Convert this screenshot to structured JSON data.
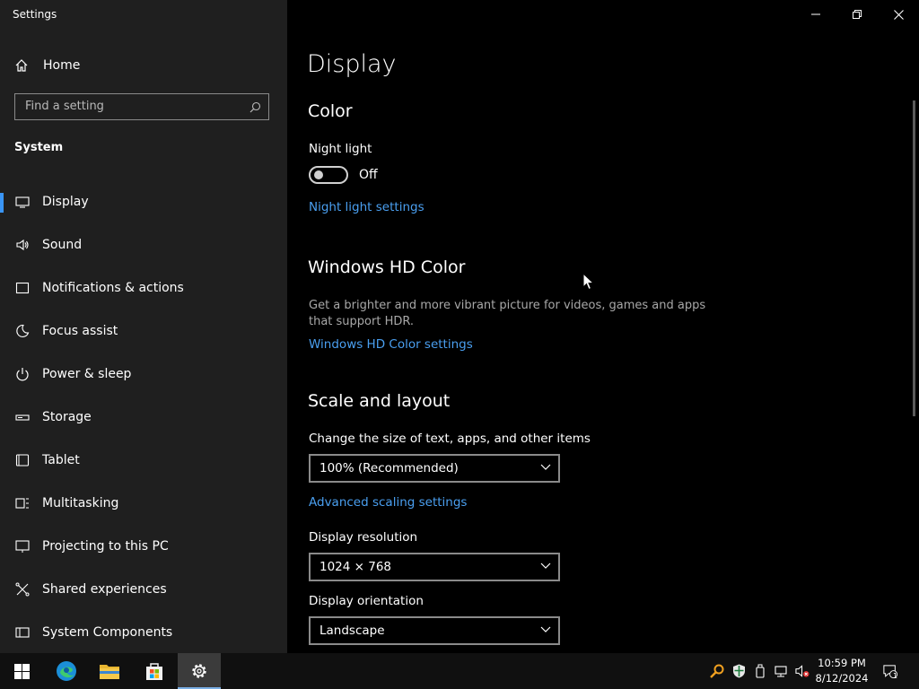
{
  "app": {
    "title": "Settings"
  },
  "sidebar": {
    "home_label": "Home",
    "search_placeholder": "Find a setting",
    "section_title": "System",
    "items": [
      {
        "label": "Display",
        "icon": "monitor-icon",
        "active": true
      },
      {
        "label": "Sound",
        "icon": "speaker-icon"
      },
      {
        "label": "Notifications & actions",
        "icon": "notification-icon"
      },
      {
        "label": "Focus assist",
        "icon": "moon-icon"
      },
      {
        "label": "Power & sleep",
        "icon": "power-icon"
      },
      {
        "label": "Storage",
        "icon": "storage-icon"
      },
      {
        "label": "Tablet",
        "icon": "tablet-icon"
      },
      {
        "label": "Multitasking",
        "icon": "multitasking-icon"
      },
      {
        "label": "Projecting to this PC",
        "icon": "projecting-icon"
      },
      {
        "label": "Shared experiences",
        "icon": "shared-icon"
      },
      {
        "label": "System Components",
        "icon": "components-icon"
      }
    ]
  },
  "main": {
    "page_title": "Display",
    "color": {
      "heading": "Color",
      "night_light_label": "Night light",
      "toggle_state": "Off",
      "night_light_link": "Night light settings"
    },
    "hdr": {
      "heading": "Windows HD Color",
      "description": "Get a brighter and more vibrant picture for videos, games and apps that support HDR.",
      "link": "Windows HD Color settings"
    },
    "scale": {
      "heading": "Scale and layout",
      "size_label": "Change the size of text, apps, and other items",
      "size_value": "100% (Recommended)",
      "advanced_link": "Advanced scaling settings",
      "resolution_label": "Display resolution",
      "resolution_value": "1024 × 768",
      "orientation_label": "Display orientation",
      "orientation_value": "Landscape"
    }
  },
  "taskbar": {
    "clock_time": "10:59 PM",
    "clock_date": "8/12/2024",
    "notification_count": "1"
  },
  "colors": {
    "accent": "#4a9ff0",
    "sidebar_bg": "#1f1f1f",
    "main_bg": "#000000"
  }
}
